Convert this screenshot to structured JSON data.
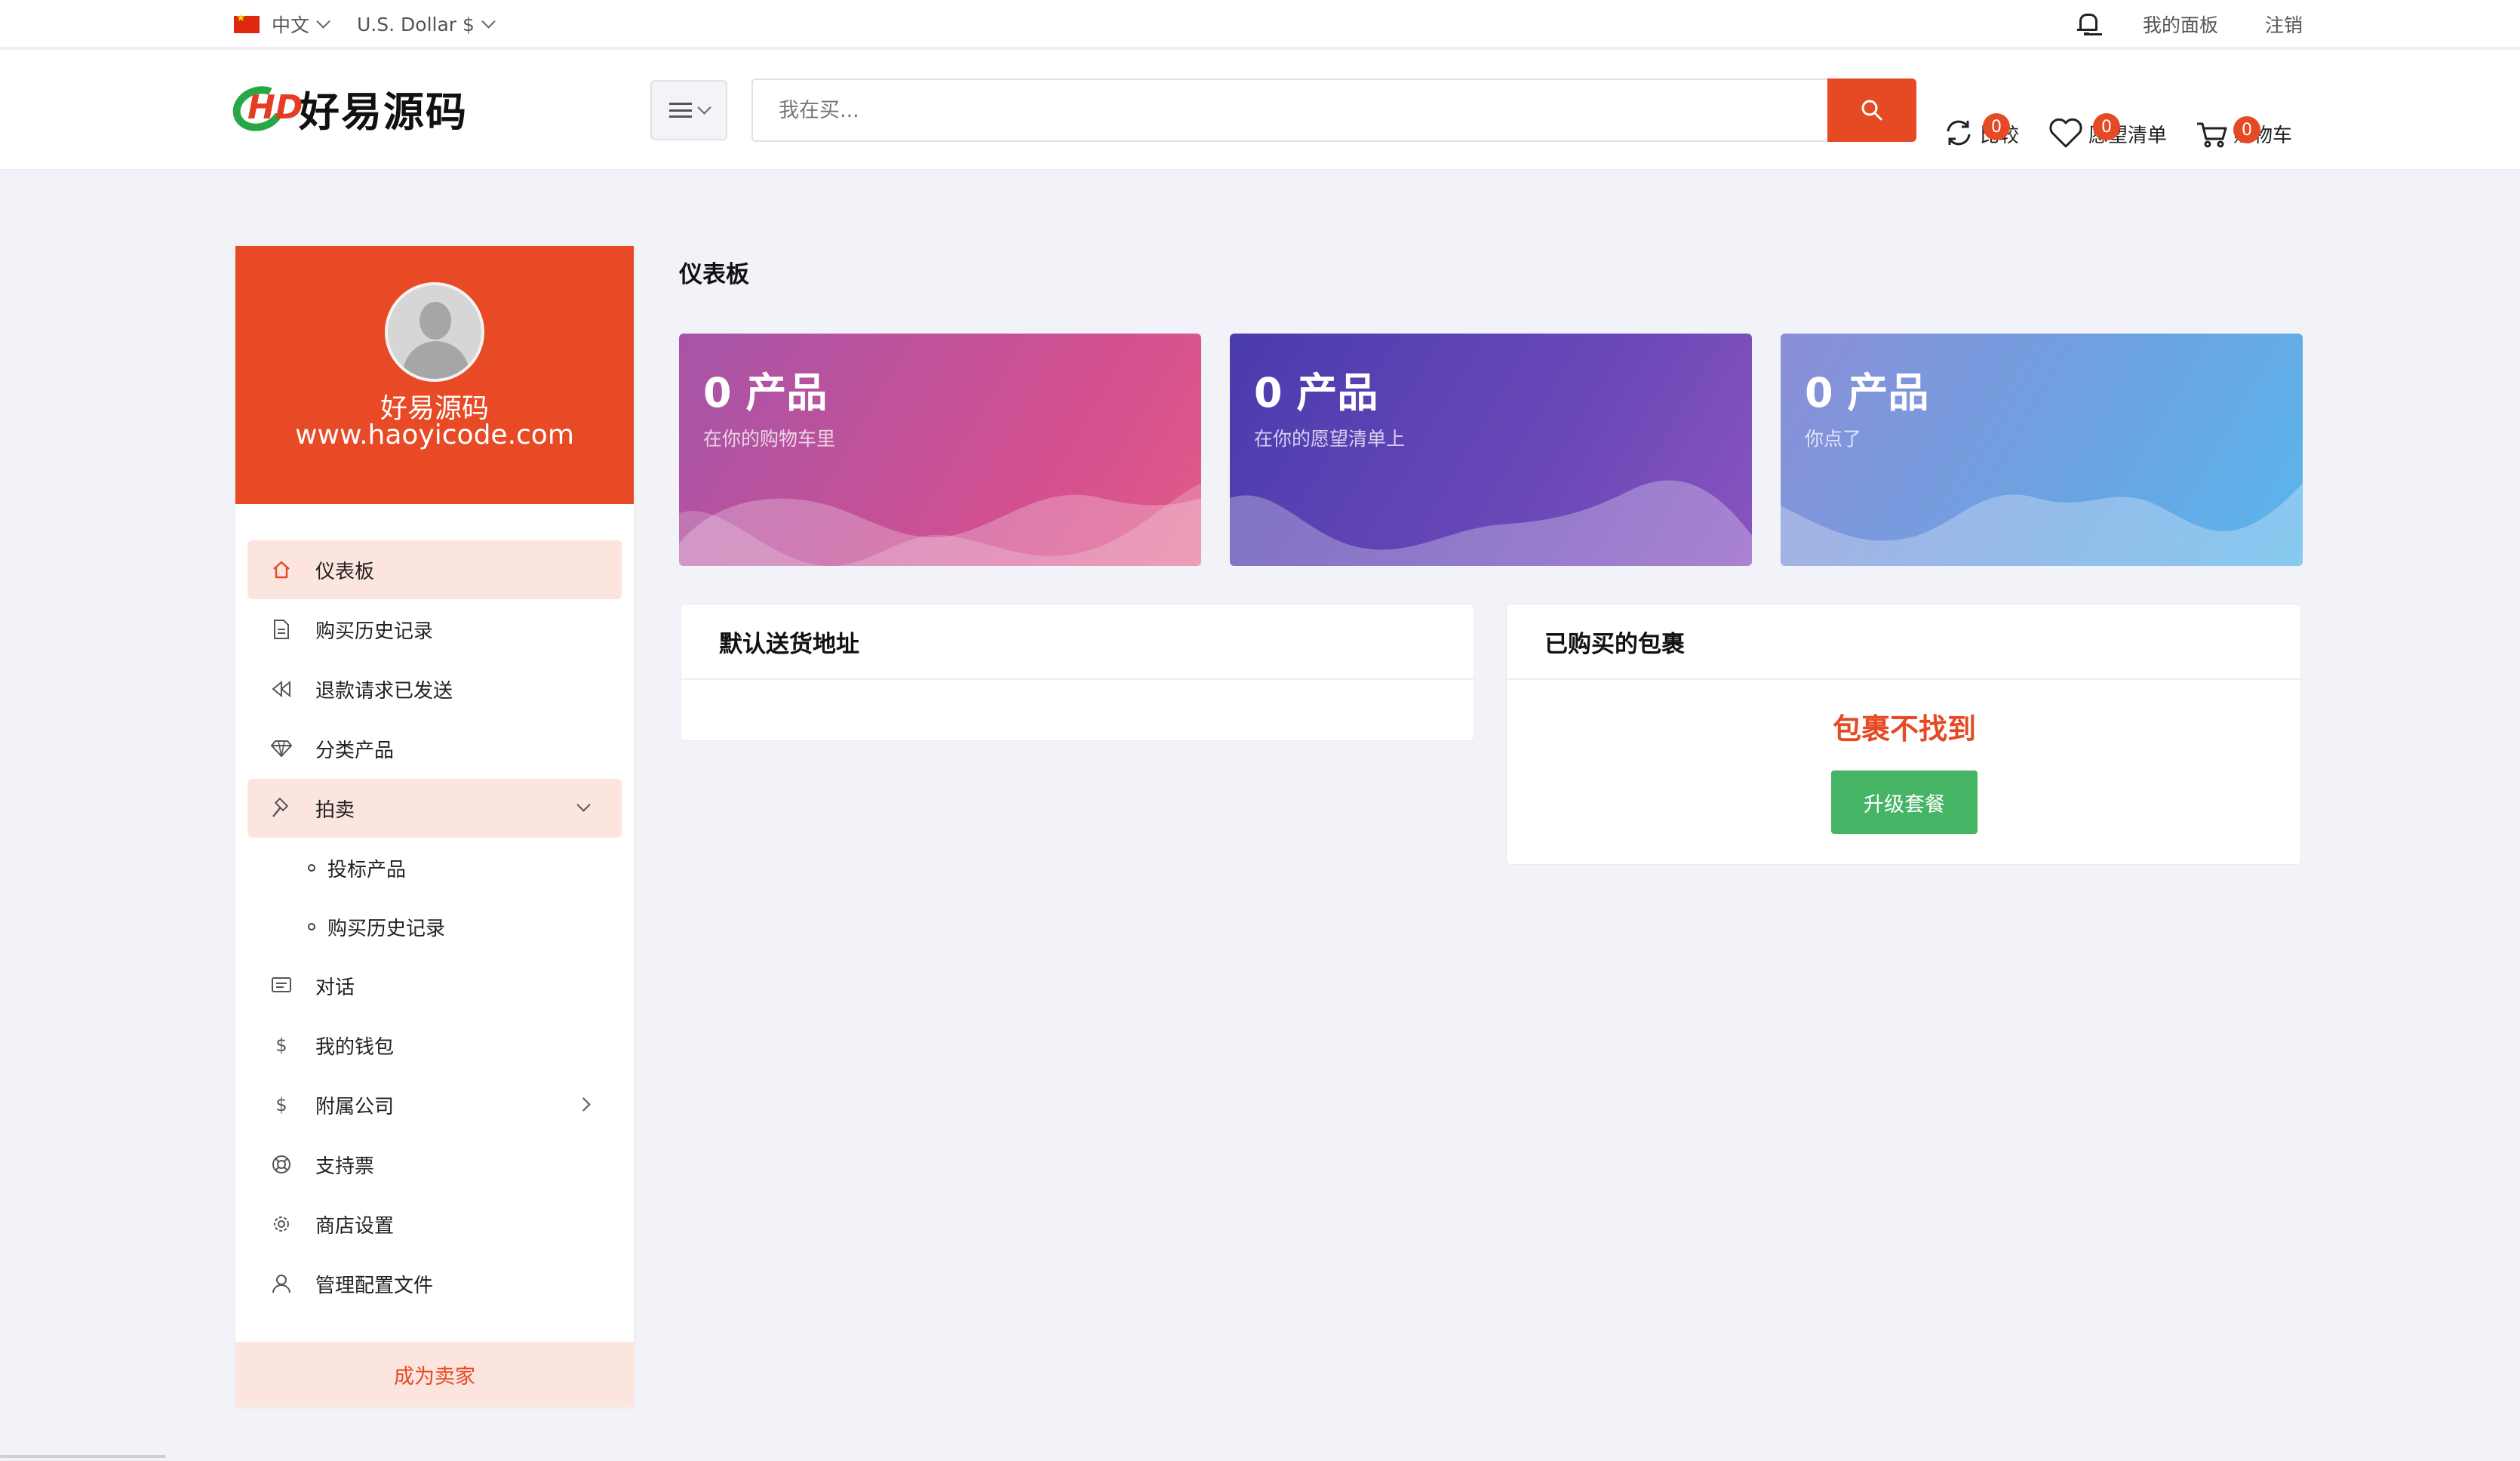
{
  "topbar": {
    "language": "中文",
    "currency": "U.S. Dollar $",
    "my_panel": "我的面板",
    "logout": "注销"
  },
  "header": {
    "logo_mark": "HD",
    "logo_text": "好易源码",
    "search_placeholder": "我在买...",
    "compare": {
      "label": "比较",
      "count": "0"
    },
    "wishlist": {
      "label": "愿望清单",
      "count": "0"
    },
    "cart": {
      "label": "购物车",
      "count": "0"
    }
  },
  "sidebar": {
    "profile_name": "好易源码",
    "profile_site": "www.haoyicode.com",
    "items": [
      {
        "label": "仪表板",
        "icon": "home-icon"
      },
      {
        "label": "购买历史记录",
        "icon": "document-icon"
      },
      {
        "label": "退款请求已发送",
        "icon": "rewind-icon"
      },
      {
        "label": "分类产品",
        "icon": "diamond-icon"
      },
      {
        "label": "拍卖",
        "icon": "gavel-icon"
      },
      {
        "label": "投标产品"
      },
      {
        "label": "购买历史记录"
      },
      {
        "label": "对话",
        "icon": "chat-icon"
      },
      {
        "label": "我的钱包",
        "icon": "dollar-icon"
      },
      {
        "label": "附属公司",
        "icon": "dollar-icon"
      },
      {
        "label": "支持票",
        "icon": "support-icon"
      },
      {
        "label": "商店设置",
        "icon": "gear-icon"
      },
      {
        "label": "管理配置文件",
        "icon": "user-icon"
      }
    ],
    "become_seller": "成为卖家"
  },
  "main": {
    "title": "仪表板",
    "cards": [
      {
        "value": "0 产品",
        "caption": "在你的购物车里"
      },
      {
        "value": "0 产品",
        "caption": "在你的愿望清单上"
      },
      {
        "value": "0 产品",
        "caption": "你点了"
      }
    ],
    "address_panel": {
      "title": "默认送货地址"
    },
    "package_panel": {
      "title": "已购买的包裹",
      "empty": "包裹不找到",
      "button": "升级套餐"
    }
  },
  "colors": {
    "accent": "#e54a24",
    "active_bg": "#fde5df",
    "success": "#46b465"
  }
}
